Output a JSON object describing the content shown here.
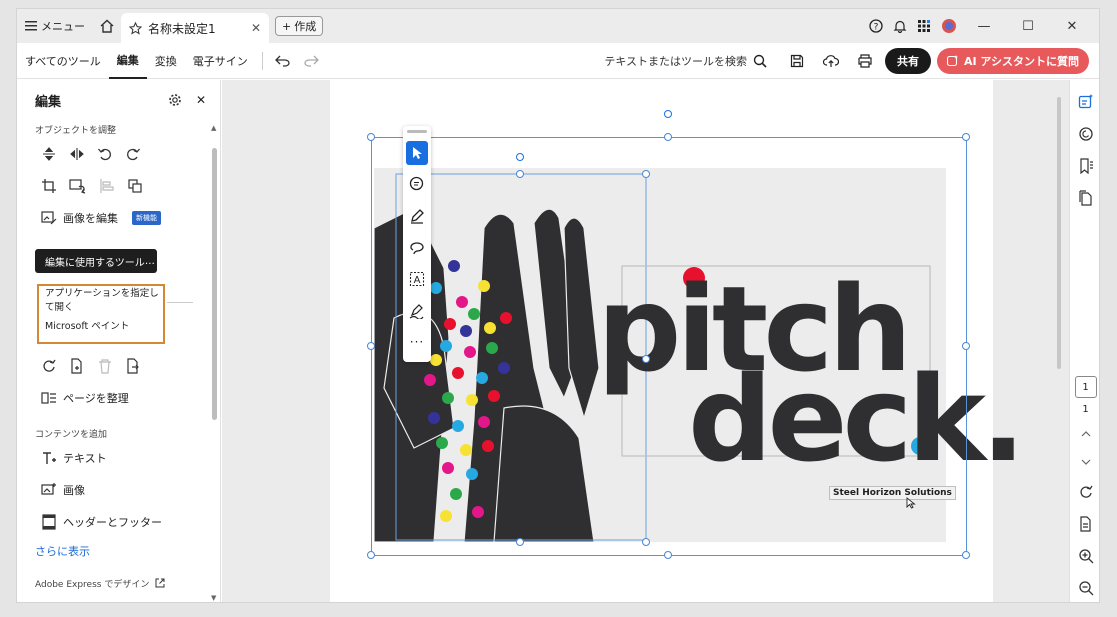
{
  "titlebar": {
    "menu_label": "メニュー",
    "tab_title": "名称未設定1",
    "new_tab_label": "作成"
  },
  "toolbar": {
    "items": [
      "すべてのツール",
      "編集",
      "変換",
      "電子サイン"
    ],
    "active_item": "編集",
    "search_label": "テキストまたはツールを検索",
    "share_label": "共有",
    "ai_label": "AI アシスタントに質問"
  },
  "panel": {
    "title": "編集",
    "section_adjust": "オブジェクトを調整",
    "edit_image_label": "画像を編集",
    "new_badge": "新機能",
    "tooltip": "編集に使用するツール",
    "dropdown_options": [
      "アプリケーションを指定して開く",
      "Microsoft ペイント"
    ],
    "organize_pages_label": "ページを整理",
    "section_add_content": "コンテンツを追加",
    "add_text_label": "テキスト",
    "add_image_label": "画像",
    "header_footer_label": "ヘッダーとフッター",
    "show_more_label": "さらに表示",
    "adobe_express_label": "Adobe Express でデザイン"
  },
  "document": {
    "headline_line1": "pitch",
    "headline_line2": "deck.",
    "caption": "Steel Horizon Solutions"
  },
  "rail": {
    "current_page": "1",
    "total_pages": "1"
  },
  "colors": {
    "accent_blue": "#1a6fe0",
    "share_bg": "#1a1a1a",
    "ai_bg": "#e8595c",
    "highlight_orange": "#d18a33",
    "dot_red": "#e8112d",
    "dot_cyan": "#25a9e0"
  }
}
